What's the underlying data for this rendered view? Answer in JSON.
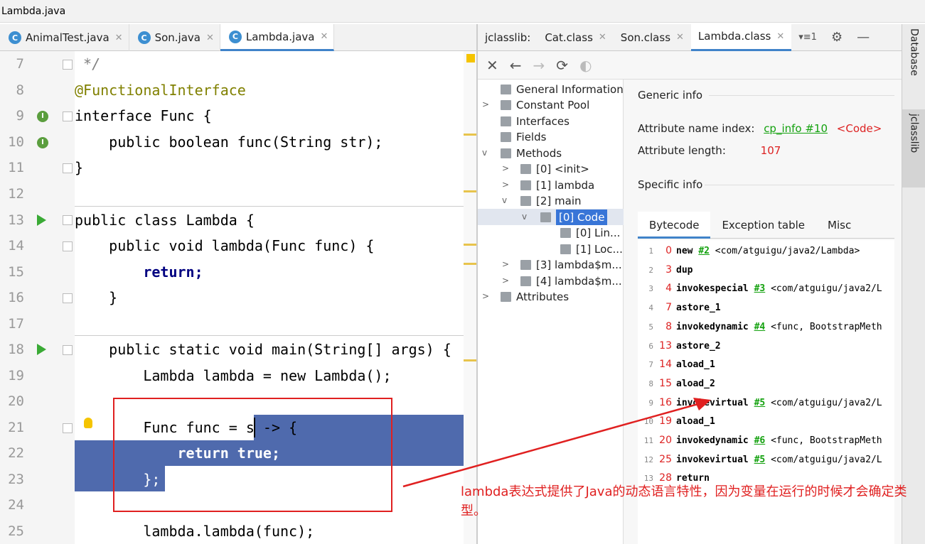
{
  "window": {
    "title": "Lambda.java"
  },
  "editor": {
    "tabs": [
      {
        "label": "AnimalTest.java"
      },
      {
        "label": "Son.java"
      },
      {
        "label": "Lambda.java"
      }
    ],
    "lines": [
      {
        "num": "7",
        "text": " */"
      },
      {
        "num": "8",
        "text": "@FunctionalInterface"
      },
      {
        "num": "9",
        "text": "interface Func {"
      },
      {
        "num": "10",
        "text": "    public boolean func(String str);"
      },
      {
        "num": "11",
        "text": "}"
      },
      {
        "num": "12",
        "text": ""
      },
      {
        "num": "13",
        "text": "public class Lambda {"
      },
      {
        "num": "14",
        "text": "    public void lambda(Func func) {"
      },
      {
        "num": "15",
        "text": "        return;"
      },
      {
        "num": "16",
        "text": "    }"
      },
      {
        "num": "17",
        "text": ""
      },
      {
        "num": "18",
        "text": "    public static void main(String[] args) {"
      },
      {
        "num": "19",
        "text": "        Lambda lambda = new Lambda();"
      },
      {
        "num": "20",
        "text": ""
      },
      {
        "num": "21",
        "text": "        Func func = s -> {"
      },
      {
        "num": "22",
        "text": "            return true;"
      },
      {
        "num": "23",
        "text": "        };"
      },
      {
        "num": "24",
        "text": ""
      },
      {
        "num": "25",
        "text": "        lambda.lambda(func);"
      }
    ]
  },
  "jclasslib": {
    "tabs": [
      {
        "label": "jclasslib:"
      },
      {
        "label": "Cat.class"
      },
      {
        "label": "Son.class"
      },
      {
        "label": "Lambda.class"
      }
    ],
    "tab_overflow": "▾≡1",
    "toolbar": {
      "close": "✕",
      "back": "←",
      "forward": "→",
      "refresh": "⟳",
      "web": "◐"
    },
    "tree": {
      "general": "General Information",
      "constant_pool": "Constant Pool",
      "interfaces": "Interfaces",
      "fields": "Fields",
      "methods": "Methods",
      "m0": "[0] <init>",
      "m1": "[1] lambda",
      "m2": "[2] main",
      "code": "[0] Code",
      "lin": "[0] Lin...",
      "loc": "[1] Loc...",
      "m3": "[3] lambda$m...",
      "m4": "[4] lambda$m...",
      "attributes": "Attributes"
    },
    "info": {
      "generic_title": "Generic info",
      "attr_name_label": "Attribute name index:",
      "attr_name_link": "cp_info #10",
      "attr_name_value": "<Code>",
      "attr_len_label": "Attribute length:",
      "attr_len_value": "107",
      "specific_title": "Specific info",
      "subtabs": [
        "Bytecode",
        "Exception table",
        "Misc"
      ]
    },
    "bytecode": [
      {
        "n": "1",
        "off": "0",
        "op": "new",
        "link": "#2",
        "arg": "<com/atguigu/java2/Lambda>"
      },
      {
        "n": "2",
        "off": "3",
        "op": "dup",
        "link": "",
        "arg": ""
      },
      {
        "n": "3",
        "off": "4",
        "op": "invokespecial",
        "link": "#3",
        "arg": "<com/atguigu/java2/L"
      },
      {
        "n": "4",
        "off": "7",
        "op": "astore_1",
        "link": "",
        "arg": ""
      },
      {
        "n": "5",
        "off": "8",
        "op": "invokedynamic",
        "link": "#4",
        "arg": "<func, BootstrapMeth"
      },
      {
        "n": "6",
        "off": "13",
        "op": "astore_2",
        "link": "",
        "arg": ""
      },
      {
        "n": "7",
        "off": "14",
        "op": "aload_1",
        "link": "",
        "arg": ""
      },
      {
        "n": "8",
        "off": "15",
        "op": "aload_2",
        "link": "",
        "arg": ""
      },
      {
        "n": "9",
        "off": "16",
        "op": "invokevirtual",
        "link": "#5",
        "arg": "<com/atguigu/java2/L"
      },
      {
        "n": "10",
        "off": "19",
        "op": "aload_1",
        "link": "",
        "arg": ""
      },
      {
        "n": "11",
        "off": "20",
        "op": "invokedynamic",
        "link": "#6",
        "arg": "<func, BootstrapMeth"
      },
      {
        "n": "12",
        "off": "25",
        "op": "invokevirtual",
        "link": "#5",
        "arg": "<com/atguigu/java2/L"
      },
      {
        "n": "13",
        "off": "28",
        "op": "return",
        "link": "",
        "arg": ""
      }
    ]
  },
  "sidebar": {
    "database": "Database",
    "jclasslib": "jclasslib"
  },
  "annotation": {
    "text": "lambda表达式提供了Java的动态语言特性，因为变量在运行的时候才会确定类型。"
  },
  "colors": {
    "selection": "#4f6aad",
    "annotation": "#e02020",
    "link": "#13a10e",
    "keyword": "#000080"
  }
}
